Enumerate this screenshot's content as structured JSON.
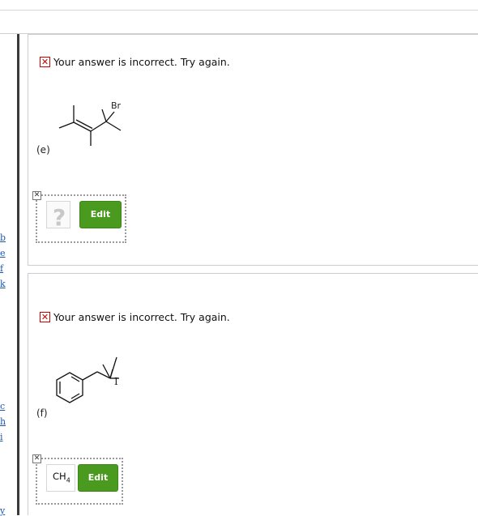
{
  "top": {
    "clipped_text": "· · · · ·"
  },
  "margin_links": [
    {
      "text": "b"
    },
    {
      "text": "e"
    },
    {
      "text": "f"
    },
    {
      "text": "k"
    },
    {
      "text": "c"
    },
    {
      "text": "h"
    },
    {
      "text": "i"
    },
    {
      "text": "y"
    }
  ],
  "questions": [
    {
      "feedback": "Your answer is incorrect.  Try again.",
      "label": "(e)",
      "atom_label": "Br",
      "answer_placeholder": "?",
      "edit_label": "Edit"
    },
    {
      "feedback": "Your answer is incorrect.  Try again.",
      "label": "(f)",
      "atom_label": "I",
      "answer_text": "CH",
      "answer_sub": "4",
      "edit_label": "Edit"
    }
  ],
  "colors": {
    "error": "#cc0000",
    "edit_button": "#4a9a1f",
    "link": "#1a57b5"
  }
}
